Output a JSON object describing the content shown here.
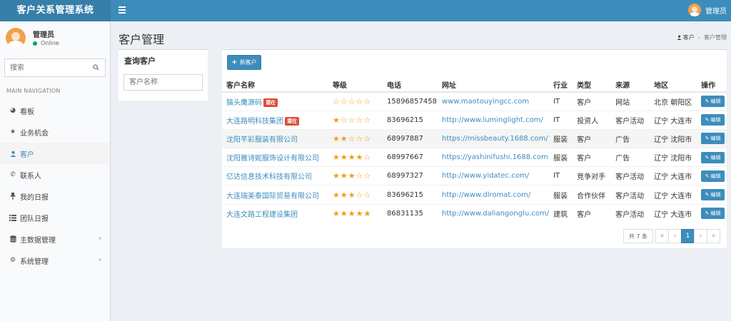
{
  "app": {
    "title": "客户关系管理系统"
  },
  "topbar": {
    "user_label": "管理员"
  },
  "sidebar": {
    "user_name": "管理员",
    "user_status": "Online",
    "search_placeholder": "搜索",
    "section_header": "MAIN NAVIGATION",
    "items": [
      {
        "label": "看板",
        "icon": "dashboard-icon"
      },
      {
        "label": "业务机会",
        "icon": "star-icon"
      },
      {
        "label": "客户",
        "icon": "user-icon",
        "active": true
      },
      {
        "label": "联系人",
        "icon": "phone-icon"
      },
      {
        "label": "我的日报",
        "icon": "pin-icon"
      },
      {
        "label": "团队日报",
        "icon": "list-icon"
      },
      {
        "label": "主数据管理",
        "icon": "database-icon",
        "expandable": true
      },
      {
        "label": "系统管理",
        "icon": "cogs-icon",
        "expandable": true
      }
    ]
  },
  "page": {
    "title": "客户管理"
  },
  "breadcrumb": {
    "parent": "客户",
    "current": "客户管理"
  },
  "filter": {
    "title": "查询客户",
    "name_placeholder": "客户名称"
  },
  "toolbar": {
    "new_label": "新客户"
  },
  "table": {
    "headers": [
      "客户名称",
      "等级",
      "电话",
      "网址",
      "行业",
      "类型",
      "来源",
      "地区",
      "操作"
    ],
    "edit_label": "编辑",
    "rows": [
      {
        "name": "猫头鹰源码",
        "tag": "潜在",
        "stars": "☆☆☆☆☆",
        "phone": "15896857458",
        "url": "www.maotouyingcc.com",
        "industry": "IT",
        "type": "客户",
        "source": "网站",
        "region": "北京 朝阳区"
      },
      {
        "name": "大连路明科技集团",
        "tag": "潜在",
        "stars": "★☆☆☆☆",
        "phone": "83696215",
        "url": "http://www.luminglight.com/",
        "industry": "IT",
        "type": "投资人",
        "source": "客户活动",
        "region": "辽宁 大连市"
      },
      {
        "name": "沈阳芊彩服装有限公司",
        "tag": "",
        "stars": "★★☆☆☆",
        "phone": "68997887",
        "url": "https://missbeauty.1688.com/",
        "industry": "服装",
        "type": "客户",
        "source": "广告",
        "region": "辽宁 沈阳市"
      },
      {
        "name": "沈阳雅诗妮服饰设计有限公司",
        "tag": "",
        "stars": "★★★★☆",
        "phone": "68997667",
        "url": "https://yashinifushi.1688.com",
        "industry": "服装",
        "type": "客户",
        "source": "广告",
        "region": "辽宁 沈阳市"
      },
      {
        "name": "亿达信息技术科技有限公司",
        "tag": "",
        "stars": "★★★☆☆",
        "phone": "68997327",
        "url": "http://www.yidatec.com/",
        "industry": "IT",
        "type": "竞争对手",
        "source": "客户活动",
        "region": "辽宁 大连市"
      },
      {
        "name": "大连瑞美泰国际贸易有限公司",
        "tag": "",
        "stars": "★★★☆☆",
        "phone": "83696215",
        "url": "http://www.dlromat.com/",
        "industry": "服装",
        "type": "合作伙伴",
        "source": "客户活动",
        "region": "辽宁 大连市"
      },
      {
        "name": "大连文路工程建设集团",
        "tag": "",
        "stars": "★★★★★",
        "phone": "86831135",
        "url": "http://www.daliangonglu.com/",
        "industry": "建筑",
        "type": "客户",
        "source": "客户活动",
        "region": "辽宁 大连市"
      }
    ]
  },
  "pagination": {
    "info": "共 7 条",
    "first": "«",
    "prev": "‹",
    "current": "1",
    "next": "›",
    "last": "»"
  },
  "colors": {
    "primary": "#3c8dbc",
    "logo_bg": "#367fa9",
    "tag": "#dd4b39",
    "star": "#f39c12",
    "online": "#00a65a"
  }
}
